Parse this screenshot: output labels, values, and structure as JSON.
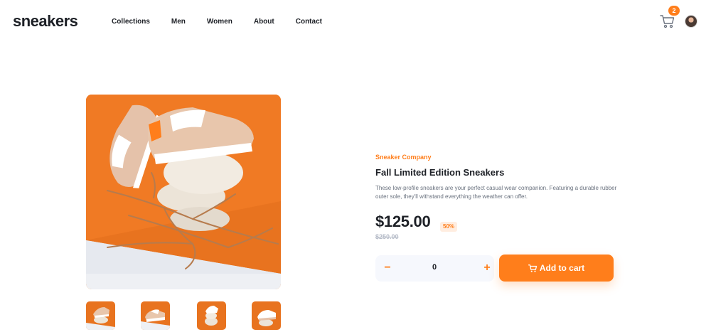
{
  "header": {
    "logo": "sneakers",
    "nav": [
      "Collections",
      "Men",
      "Women",
      "About",
      "Contact"
    ],
    "cart_count": "2",
    "cart_icon": "cart-icon",
    "avatar_icon": "avatar"
  },
  "product": {
    "company": "Sneaker Company",
    "title": "Fall Limited Edition Sneakers",
    "description": "These low-profile sneakers are your perfect casual wear companion. Featuring a durable rubber outer sole, they'll withstand everything the weather can offer.",
    "price": "$125.00",
    "discount": "50%",
    "original_price": "$250.00"
  },
  "quantity": {
    "minus": "−",
    "value": "0",
    "plus": "+"
  },
  "add_to_cart": {
    "label": "Add to cart",
    "icon": "cart-icon"
  },
  "gallery": {
    "thumbnails": [
      "thumbnail-1",
      "thumbnail-2",
      "thumbnail-3",
      "thumbnail-4"
    ]
  },
  "colors": {
    "accent": "#ff7e1b",
    "accent_pale": "#ffede0",
    "text_dark": "#1d2026",
    "text_gray": "#68707d",
    "text_light": "#b6bcc8",
    "qty_bg": "#f6f8fd"
  }
}
